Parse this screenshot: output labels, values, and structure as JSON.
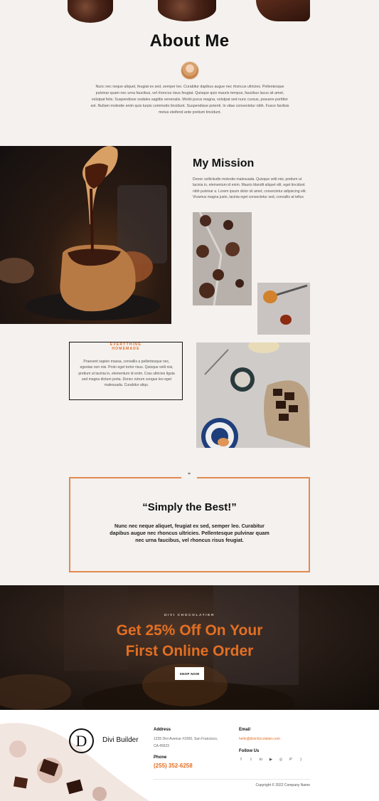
{
  "about": {
    "title": "About Me",
    "text": "Nunc nec neque aliquet, feugiat ex sed, semper leo. Curabitur dapibus augue nec rhoncus ultricies. Pellentesque pulvinar quam nec urna faucibus, vel rhoncus risus feugiat. Quisque quis mauris tempus, faucibus lacus sit amet, volutpat felis. Suspendisse sodales sagittis venenatis. Morbi purus magna, volutpat sed nunc cursus, posuere porttitor est. Nullam molestie enim quis turpis commodo tincidunt. Suspendisse potenti. In vitae consectetur nibh. Fusce facilisis metus eleifend ante pretium tincidunt."
  },
  "mission": {
    "title": "My Mission",
    "text": "Donec sollicitudin molestie malesuada. Quisque velit nisi, pretium ut lacinia in, elementum id enim. Mauris blandit aliquet elit, eget tincidunt nibh pulvinar a. Lorem ipsum dolor sit amet, consectetur adipiscing elit. Vivamus magna justo, lacinia eget consectetur sed, convallis at tellus"
  },
  "homemade": {
    "label_line1": "EVERYTHING",
    "label_line2": "HOMEMADE",
    "text": "Praesent sapien massa, convallis a pellentesque nec, egestas non nisi. Proin eget tortor risus. Quisque velit nisi, pretium ut lacinia in, elementum id enim. Cras ultricies ligula sed magna dictum porta. Donec rutrum congue leo eget malesuada. Curabitur aliqu."
  },
  "quote": {
    "mark": "”",
    "title": "“Simply the Best!”",
    "text": "Nunc nec neque aliquet, feugiat ex sed, semper leo. Curabitur dapibus augue nec rhoncus ultricies. Pellentesque pulvinar quam nec urna faucibus, vel rhoncus risus feugiat."
  },
  "promo": {
    "eyebrow": "DIVI CHOCOLATIER",
    "title_line1": "Get 25% Off On Your",
    "title_line2": "First Online Order",
    "button": "SHOP NOW"
  },
  "footer": {
    "logo_letter": "D",
    "brand": "Divi Builder",
    "address_head": "Address",
    "address_line1": "1235 Divi Avenue #1000, San Francisco,",
    "address_line2": "CA 45623",
    "phone_head": "Phone",
    "phone": "(255) 352-6258",
    "email_head": "Email",
    "email": "hello@divichocolatier.com",
    "follow_head": "Follow Us",
    "socials": [
      "f",
      "t",
      "in",
      "▶",
      "◎",
      "P",
      ")"
    ],
    "copyright": "Copyright © 2022 Company Name"
  },
  "colors": {
    "accent": "#e36f23",
    "background": "#f4f1ee",
    "quote_border": "#e38a4f"
  },
  "icons": [
    "facebook-icon",
    "twitter-icon",
    "linkedin-icon",
    "youtube-icon",
    "instagram-icon",
    "pinterest-icon",
    "rss-icon"
  ]
}
